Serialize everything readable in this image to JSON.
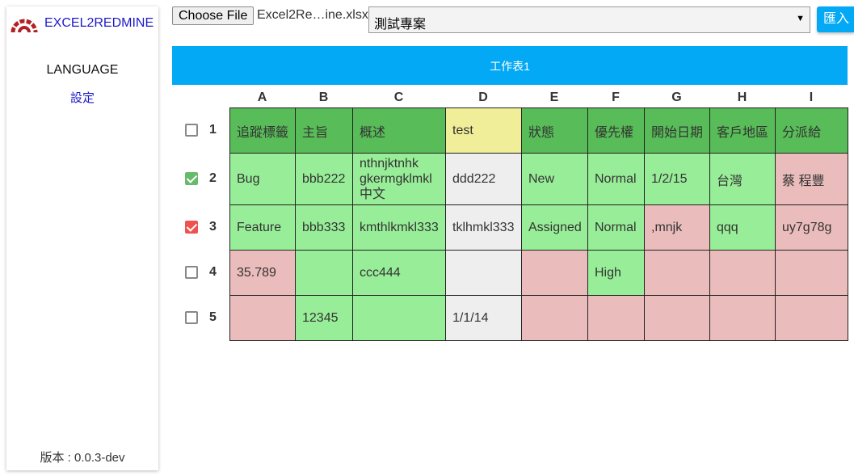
{
  "sidebar": {
    "brand": "EXCEL2REDMINE",
    "language": "LANGUAGE",
    "settings": "設定",
    "version": "版本 : 0.0.3-dev"
  },
  "toolbar": {
    "choose_file": "Choose File",
    "file_name": "Excel2Re…ine.xlsx",
    "project": "測試專案",
    "import": "匯入"
  },
  "sheet": {
    "tab": "工作表1",
    "columns": [
      "A",
      "B",
      "C",
      "D",
      "E",
      "F",
      "G",
      "H",
      "I"
    ],
    "rows": [
      {
        "num": "1",
        "checked": "none",
        "cells": [
          "追蹤標籤",
          "主旨",
          "概述",
          "test",
          "狀態",
          "優先權",
          "開始日期",
          "客戶地區",
          "分派給"
        ]
      },
      {
        "num": "2",
        "checked": "green",
        "cells": [
          "Bug",
          "bbb222",
          "nthnjktnhk gkermgklmkl 中文",
          "ddd222",
          "New",
          "Normal",
          "1/2/15",
          "台灣",
          "蔡 程豐"
        ]
      },
      {
        "num": "3",
        "checked": "red",
        "cells": [
          "Feature",
          "bbb333",
          "kmthlkmkl333",
          "tklhmkl333",
          "Assigned",
          "Normal",
          ",mnjk",
          "qqq",
          "uy7g78g"
        ]
      },
      {
        "num": "4",
        "checked": "none",
        "cells": [
          "35.789",
          "",
          "ccc444",
          "",
          "",
          "High",
          "",
          "",
          ""
        ]
      },
      {
        "num": "5",
        "checked": "none",
        "cells": [
          "",
          "12345",
          "",
          "1/1/14",
          "",
          "",
          "",
          "",
          ""
        ]
      }
    ]
  },
  "colors": {
    "accent": "#03a9f4",
    "header_green": "#58bd58",
    "valid_green": "#98ee98",
    "invalid_red": "#ebbcbc",
    "neutral_gray": "#eeeeee",
    "custom_yellow": "#f0ee98"
  }
}
